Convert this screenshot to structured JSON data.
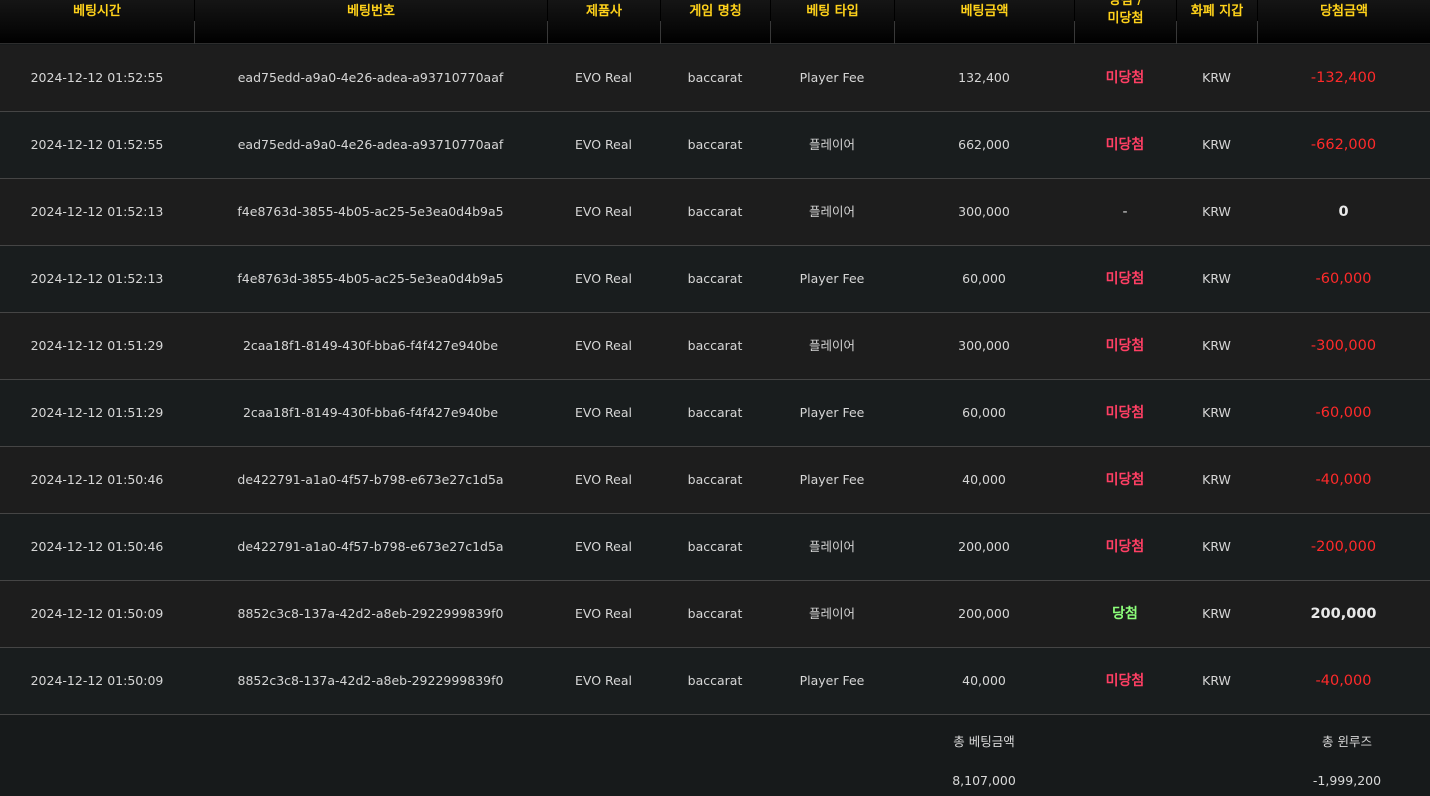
{
  "columns": [
    "베팅시간",
    "베팅번호",
    "제품사",
    "게임 명칭",
    "베팅 타입",
    "베팅금액",
    "당첨 /\n미당첨",
    "화폐 지갑",
    "당첨금액"
  ],
  "rows": [
    {
      "time": "2024-12-12 01:52:55",
      "bet_id": "ead75edd-a9a0-4e26-adea-a93710770aaf",
      "provider": "EVO Real",
      "game": "baccarat",
      "bet_type": "Player Fee",
      "bet_amount": "132,400",
      "result": "미당첨",
      "result_state": "lose",
      "currency": "KRW",
      "win_amount": "-132,400",
      "amount_state": "neg"
    },
    {
      "time": "2024-12-12 01:52:55",
      "bet_id": "ead75edd-a9a0-4e26-adea-a93710770aaf",
      "provider": "EVO Real",
      "game": "baccarat",
      "bet_type": "플레이어",
      "bet_amount": "662,000",
      "result": "미당첨",
      "result_state": "lose",
      "currency": "KRW",
      "win_amount": "-662,000",
      "amount_state": "neg"
    },
    {
      "time": "2024-12-12 01:52:13",
      "bet_id": "f4e8763d-3855-4b05-ac25-5e3ea0d4b9a5",
      "provider": "EVO Real",
      "game": "baccarat",
      "bet_type": "플레이어",
      "bet_amount": "300,000",
      "result": "-",
      "result_state": "none",
      "currency": "KRW",
      "win_amount": "0",
      "amount_state": "zero"
    },
    {
      "time": "2024-12-12 01:52:13",
      "bet_id": "f4e8763d-3855-4b05-ac25-5e3ea0d4b9a5",
      "provider": "EVO Real",
      "game": "baccarat",
      "bet_type": "Player Fee",
      "bet_amount": "60,000",
      "result": "미당첨",
      "result_state": "lose",
      "currency": "KRW",
      "win_amount": "-60,000",
      "amount_state": "neg"
    },
    {
      "time": "2024-12-12 01:51:29",
      "bet_id": "2caa18f1-8149-430f-bba6-f4f427e940be",
      "provider": "EVO Real",
      "game": "baccarat",
      "bet_type": "플레이어",
      "bet_amount": "300,000",
      "result": "미당첨",
      "result_state": "lose",
      "currency": "KRW",
      "win_amount": "-300,000",
      "amount_state": "neg"
    },
    {
      "time": "2024-12-12 01:51:29",
      "bet_id": "2caa18f1-8149-430f-bba6-f4f427e940be",
      "provider": "EVO Real",
      "game": "baccarat",
      "bet_type": "Player Fee",
      "bet_amount": "60,000",
      "result": "미당첨",
      "result_state": "lose",
      "currency": "KRW",
      "win_amount": "-60,000",
      "amount_state": "neg"
    },
    {
      "time": "2024-12-12 01:50:46",
      "bet_id": "de422791-a1a0-4f57-b798-e673e27c1d5a",
      "provider": "EVO Real",
      "game": "baccarat",
      "bet_type": "Player Fee",
      "bet_amount": "40,000",
      "result": "미당첨",
      "result_state": "lose",
      "currency": "KRW",
      "win_amount": "-40,000",
      "amount_state": "neg"
    },
    {
      "time": "2024-12-12 01:50:46",
      "bet_id": "de422791-a1a0-4f57-b798-e673e27c1d5a",
      "provider": "EVO Real",
      "game": "baccarat",
      "bet_type": "플레이어",
      "bet_amount": "200,000",
      "result": "미당첨",
      "result_state": "lose",
      "currency": "KRW",
      "win_amount": "-200,000",
      "amount_state": "neg"
    },
    {
      "time": "2024-12-12 01:50:09",
      "bet_id": "8852c3c8-137a-42d2-a8eb-2922999839f0",
      "provider": "EVO Real",
      "game": "baccarat",
      "bet_type": "플레이어",
      "bet_amount": "200,000",
      "result": "당첨",
      "result_state": "win",
      "currency": "KRW",
      "win_amount": "200,000",
      "amount_state": "pos"
    },
    {
      "time": "2024-12-12 01:50:09",
      "bet_id": "8852c3c8-137a-42d2-a8eb-2922999839f0",
      "provider": "EVO Real",
      "game": "baccarat",
      "bet_type": "Player Fee",
      "bet_amount": "40,000",
      "result": "미당첨",
      "result_state": "lose",
      "currency": "KRW",
      "win_amount": "-40,000",
      "amount_state": "neg"
    }
  ],
  "summary": {
    "total_bet_label": "총 베팅금액",
    "total_bet_value": "8,107,000",
    "total_winloss_label": "총 윈루즈",
    "total_winloss_value": "-1,999,200"
  },
  "colors": {
    "header_text": "#ffd21a",
    "lose": "#ff3f64",
    "win": "#8dff7a",
    "negative_amount": "#ff2a2a"
  }
}
